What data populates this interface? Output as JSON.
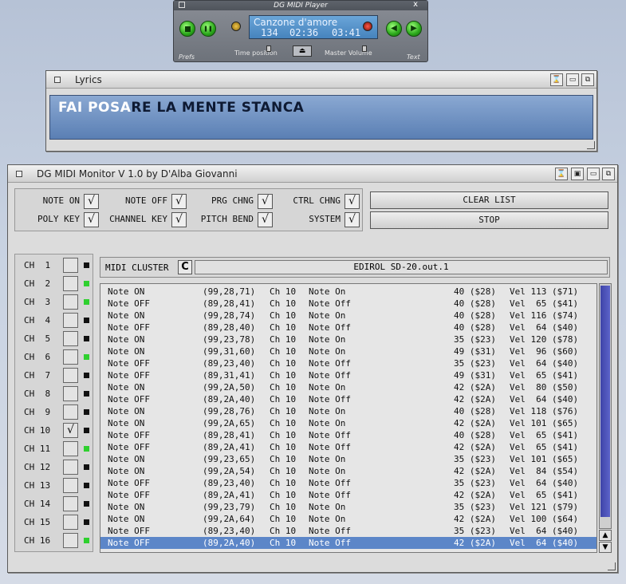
{
  "player": {
    "title": "DG MIDI Player",
    "close_glyph": "x",
    "song": "Canzone d'amore",
    "track_number": "134",
    "time_elapsed": "02:36",
    "time_total": "03:41",
    "prefs_label": "Prefs",
    "time_position_label": "Time position",
    "master_volume_label": "Master Volume",
    "text_label": "Text",
    "eject_glyph": "⏏",
    "rewind_glyph": "◀",
    "forward_glyph": "▶",
    "pause_glyph": "❚❚"
  },
  "lyrics": {
    "title": "Lyrics",
    "sung": "FAI POSA",
    "remaining": "RE LA MENTE STANCA"
  },
  "monitor": {
    "title": "DG MIDI Monitor V 1.0 by D'Alba Giovanni",
    "check_glyph": "√",
    "flags": [
      {
        "label": "NOTE ON",
        "checked": "√"
      },
      {
        "label": "NOTE OFF",
        "checked": "√"
      },
      {
        "label": "PRG CHNG",
        "checked": "√"
      },
      {
        "label": "CTRL CHNG",
        "checked": "√"
      },
      {
        "label": "POLY KEY",
        "checked": "√"
      },
      {
        "label": "CHANNEL KEY",
        "checked": "√"
      },
      {
        "label": "PITCH BEND",
        "checked": "√"
      },
      {
        "label": "SYSTEM",
        "checked": "√"
      }
    ],
    "clear_list_label": "CLEAR LIST",
    "stop_label": "STOP",
    "channels": [
      {
        "label": "CH  1",
        "checked": "",
        "led": "#111111"
      },
      {
        "label": "CH  2",
        "checked": "",
        "led": "#2fd02f"
      },
      {
        "label": "CH  3",
        "checked": "",
        "led": "#2fd02f"
      },
      {
        "label": "CH  4",
        "checked": "",
        "led": "#111111"
      },
      {
        "label": "CH  5",
        "checked": "",
        "led": "#111111"
      },
      {
        "label": "CH  6",
        "checked": "",
        "led": "#2fd02f"
      },
      {
        "label": "CH  7",
        "checked": "",
        "led": "#111111"
      },
      {
        "label": "CH  8",
        "checked": "",
        "led": "#111111"
      },
      {
        "label": "CH  9",
        "checked": "",
        "led": "#111111"
      },
      {
        "label": "CH 10",
        "checked": "√",
        "led": "#111111"
      },
      {
        "label": "CH 11",
        "checked": "",
        "led": "#2fd02f"
      },
      {
        "label": "CH 12",
        "checked": "",
        "led": "#111111"
      },
      {
        "label": "CH 13",
        "checked": "",
        "led": "#111111"
      },
      {
        "label": "CH 14",
        "checked": "",
        "led": "#111111"
      },
      {
        "label": "CH 15",
        "checked": "",
        "led": "#111111"
      },
      {
        "label": "CH 16",
        "checked": "",
        "led": "#2fd02f"
      }
    ],
    "cluster_label": "MIDI CLUSTER",
    "cycle_glyph": "C",
    "cluster_value": "EDIROL SD-20.out.1",
    "scroll_up": "▲",
    "scroll_down": "▼",
    "events": [
      [
        "Note ON",
        "(99,28,71)",
        "Ch 10",
        "Note On",
        "40 ($28)",
        "Vel 113 ($71)"
      ],
      [
        "Note OFF",
        "(89,28,41)",
        "Ch 10",
        "Note Off",
        "40 ($28)",
        "Vel  65 ($41)"
      ],
      [
        "Note ON",
        "(99,28,74)",
        "Ch 10",
        "Note On",
        "40 ($28)",
        "Vel 116 ($74)"
      ],
      [
        "Note OFF",
        "(89,28,40)",
        "Ch 10",
        "Note Off",
        "40 ($28)",
        "Vel  64 ($40)"
      ],
      [
        "Note ON",
        "(99,23,78)",
        "Ch 10",
        "Note On",
        "35 ($23)",
        "Vel 120 ($78)"
      ],
      [
        "Note ON",
        "(99,31,60)",
        "Ch 10",
        "Note On",
        "49 ($31)",
        "Vel  96 ($60)"
      ],
      [
        "Note OFF",
        "(89,23,40)",
        "Ch 10",
        "Note Off",
        "35 ($23)",
        "Vel  64 ($40)"
      ],
      [
        "Note OFF",
        "(89,31,41)",
        "Ch 10",
        "Note Off",
        "49 ($31)",
        "Vel  65 ($41)"
      ],
      [
        "Note ON",
        "(99,2A,50)",
        "Ch 10",
        "Note On",
        "42 ($2A)",
        "Vel  80 ($50)"
      ],
      [
        "Note OFF",
        "(89,2A,40)",
        "Ch 10",
        "Note Off",
        "42 ($2A)",
        "Vel  64 ($40)"
      ],
      [
        "Note ON",
        "(99,28,76)",
        "Ch 10",
        "Note On",
        "40 ($28)",
        "Vel 118 ($76)"
      ],
      [
        "Note ON",
        "(99,2A,65)",
        "Ch 10",
        "Note On",
        "42 ($2A)",
        "Vel 101 ($65)"
      ],
      [
        "Note OFF",
        "(89,28,41)",
        "Ch 10",
        "Note Off",
        "40 ($28)",
        "Vel  65 ($41)"
      ],
      [
        "Note OFF",
        "(89,2A,41)",
        "Ch 10",
        "Note Off",
        "42 ($2A)",
        "Vel  65 ($41)"
      ],
      [
        "Note ON",
        "(99,23,65)",
        "Ch 10",
        "Note On",
        "35 ($23)",
        "Vel 101 ($65)"
      ],
      [
        "Note ON",
        "(99,2A,54)",
        "Ch 10",
        "Note On",
        "42 ($2A)",
        "Vel  84 ($54)"
      ],
      [
        "Note OFF",
        "(89,23,40)",
        "Ch 10",
        "Note Off",
        "35 ($23)",
        "Vel  64 ($40)"
      ],
      [
        "Note OFF",
        "(89,2A,41)",
        "Ch 10",
        "Note Off",
        "42 ($2A)",
        "Vel  65 ($41)"
      ],
      [
        "Note ON",
        "(99,23,79)",
        "Ch 10",
        "Note On",
        "35 ($23)",
        "Vel 121 ($79)"
      ],
      [
        "Note ON",
        "(99,2A,64)",
        "Ch 10",
        "Note On",
        "42 ($2A)",
        "Vel 100 ($64)"
      ],
      [
        "Note OFF",
        "(89,23,40)",
        "Ch 10",
        "Note Off",
        "35 ($23)",
        "Vel  64 ($40)"
      ],
      [
        "Note OFF",
        "(89,2A,40)",
        "Ch 10",
        "Note Off",
        "42 ($2A)",
        "Vel  64 ($40)"
      ]
    ],
    "selected_row": 21
  }
}
